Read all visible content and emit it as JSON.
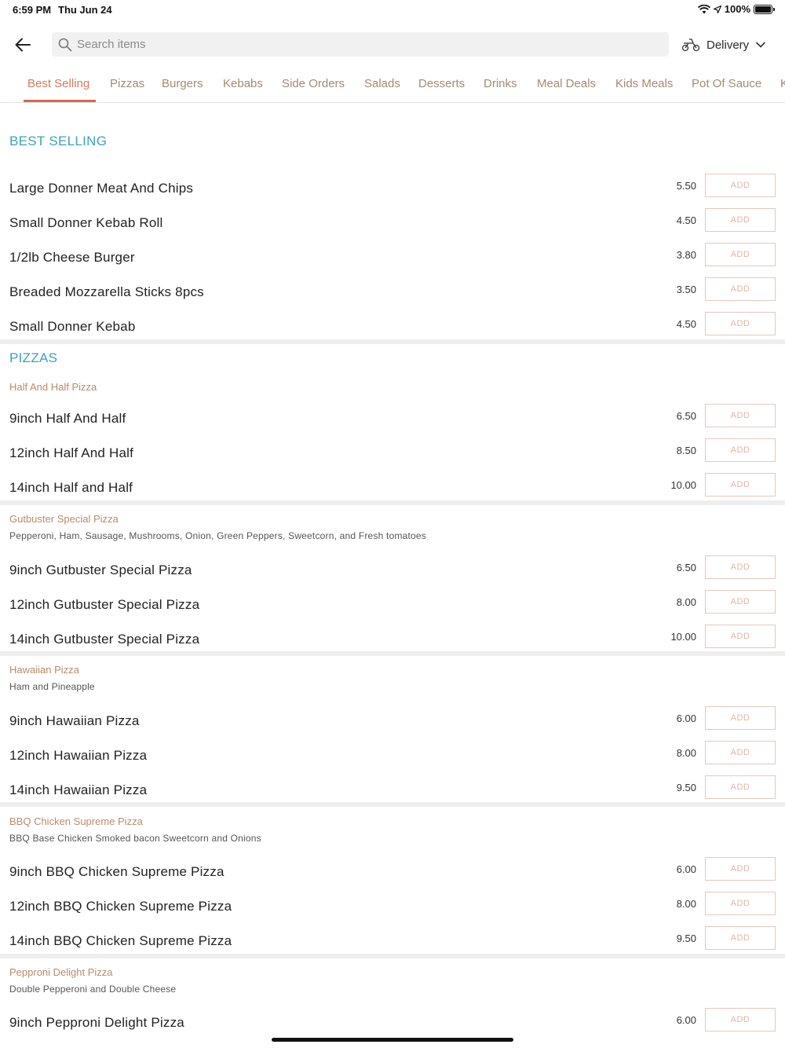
{
  "status_bar": {
    "time": "6:59 PM",
    "date": "Thu Jun 24",
    "battery": "100%"
  },
  "search": {
    "placeholder": "Search items"
  },
  "delivery": {
    "label": "Delivery"
  },
  "tabs": [
    "Best Selling",
    "Pizzas",
    "Burgers",
    "Kebabs",
    "Side Orders",
    "Salads",
    "Desserts",
    "Drinks",
    "Meal Deals",
    "Kids Meals",
    "Pot Of Sauce",
    "K"
  ],
  "add_label": "ADD",
  "best_selling": {
    "title": "BEST SELLING",
    "items": [
      {
        "name": "Large Donner Meat And Chips",
        "price": "5.50"
      },
      {
        "name": "Small Donner Kebab Roll",
        "price": "4.50"
      },
      {
        "name": "1/2lb Cheese Burger",
        "price": "3.80"
      },
      {
        "name": "Breaded Mozzarella Sticks 8pcs",
        "price": "3.50"
      },
      {
        "name": "Small Donner Kebab",
        "price": "4.50"
      }
    ]
  },
  "pizzas": {
    "title": "PIZZAS",
    "groups": [
      {
        "title": "Half And Half Pizza",
        "desc": "",
        "items": [
          {
            "name": "9inch Half And Half",
            "price": "6.50"
          },
          {
            "name": "12inch Half And Half",
            "price": "8.50"
          },
          {
            "name": "14inch Half and Half",
            "price": "10.00"
          }
        ]
      },
      {
        "title": "Gutbuster Special Pizza",
        "desc": "Pepperoni, Ham, Sausage, Mushrooms, Onion, Green Peppers, Sweetcorn, and Fresh tomatoes",
        "items": [
          {
            "name": "9inch Gutbuster Special Pizza",
            "price": "6.50"
          },
          {
            "name": "12inch Gutbuster Special Pizza",
            "price": "8.00"
          },
          {
            "name": "14inch Gutbuster Special Pizza",
            "price": "10.00"
          }
        ]
      },
      {
        "title": "Hawaiian Pizza",
        "desc": "Ham and Pineapple",
        "items": [
          {
            "name": "9inch Hawaiian Pizza",
            "price": "6.00"
          },
          {
            "name": "12inch Hawaiian Pizza",
            "price": "8.00"
          },
          {
            "name": "14inch Hawaiian Pizza",
            "price": "9.50"
          }
        ]
      },
      {
        "title": "BBQ Chicken Supreme Pizza",
        "desc": "BBQ Base Chicken Smoked bacon Sweetcorn and Onions",
        "items": [
          {
            "name": "9inch BBQ Chicken Supreme Pizza",
            "price": "6.00"
          },
          {
            "name": "12inch BBQ Chicken Supreme Pizza",
            "price": "8.00"
          },
          {
            "name": "14inch BBQ Chicken Supreme Pizza",
            "price": "9.50"
          }
        ]
      },
      {
        "title": "Pepproni Delight Pizza",
        "desc": "Double Pepperoni and Double Cheese",
        "items": [
          {
            "name": "9inch Pepproni Delight Pizza",
            "price": "6.00"
          }
        ]
      }
    ]
  }
}
